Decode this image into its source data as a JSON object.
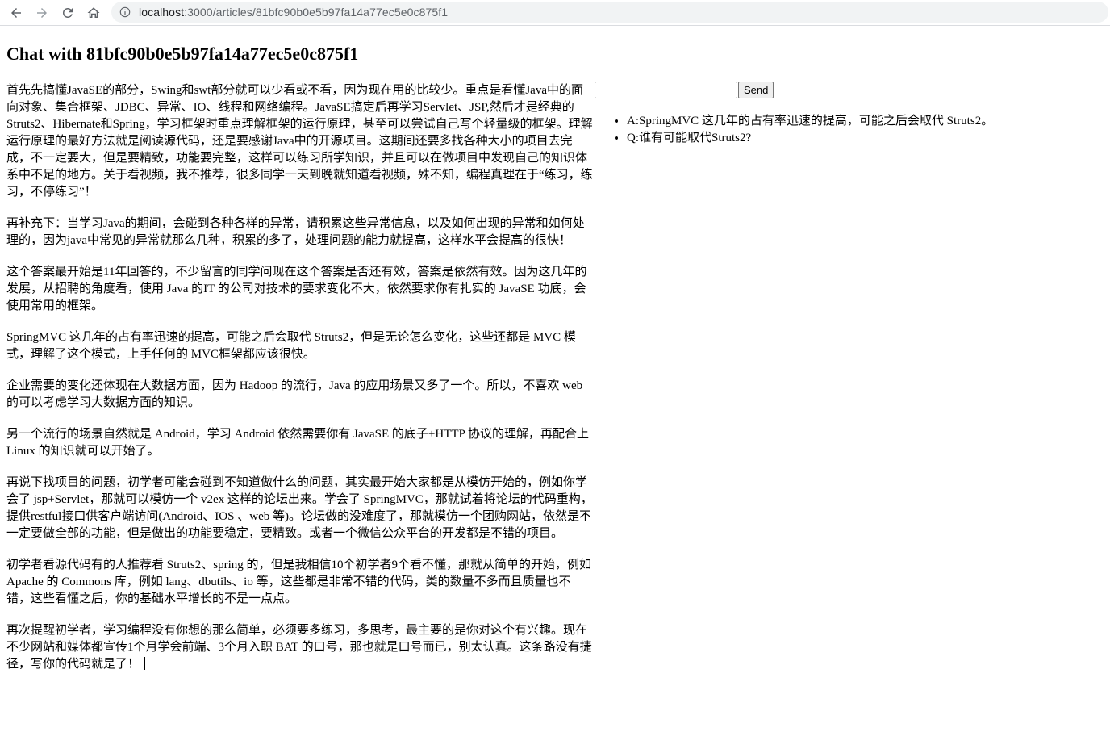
{
  "browser": {
    "url_host": "localhost",
    "url_path": ":3000/articles/81bfc90b0e5b97fa14a77ec5e0c875f1",
    "icons": {
      "back": "arrow-left-icon",
      "forward": "arrow-right-icon",
      "reload": "reload-icon",
      "home": "home-icon",
      "info": "info-icon"
    }
  },
  "page": {
    "title": "Chat with 81bfc90b0e5b97fa14a77ec5e0c875f1"
  },
  "article": {
    "paragraphs": [
      "首先先搞懂JavaSE的部分，Swing和swt部分就可以少看或不看，因为现在用的比较少。重点是看懂Java中的面向对象、集合框架、JDBC、异常、IO、线程和网络编程。JavaSE搞定后再学习Servlet、JSP,然后才是经典的Struts2、Hibernate和Spring，学习框架时重点理解框架的运行原理，甚至可以尝试自己写个轻量级的框架。理解运行原理的最好方法就是阅读源代码，还是要感谢Java中的开源项目。这期间还要多找各种大小的项目去完成，不一定要大，但是要精致，功能要完整，这样可以练习所学知识，并且可以在做项目中发现自己的知识体系中不足的地方。关于看视频，我不推荐，很多同学一天到晚就知道看视频，殊不知，编程真理在于“练习，练习，不停练习”！",
      "再补充下：当学习Java的期间，会碰到各种各样的异常，请积累这些异常信息，以及如何出现的异常和如何处理的，因为java中常见的异常就那么几种，积累的多了，处理问题的能力就提高，这样水平会提高的很快！",
      "这个答案最开始是11年回答的，不少留言的同学问现在这个答案是否还有效，答案是依然有效。因为这几年的发展，从招聘的角度看，使用 Java 的IT 的公司对技术的要求变化不大，依然要求你有扎实的 JavaSE 功底，会使用常用的框架。",
      "SpringMVC 这几年的占有率迅速的提高，可能之后会取代 Struts2，但是无论怎么变化，这些还都是 MVC 模式，理解了这个模式，上手任何的 MVC框架都应该很快。",
      "企业需要的变化还体现在大数据方面，因为 Hadoop 的流行，Java 的应用场景又多了一个。所以，不喜欢 web 的可以考虑学习大数据方面的知识。",
      "另一个流行的场景自然就是 Android，学习 Android 依然需要你有 JavaSE 的底子+HTTP 协议的理解，再配合上 Linux 的知识就可以开始了。",
      "再说下找项目的问题，初学者可能会碰到不知道做什么的问题，其实最开始大家都是从模仿开始的，例如你学会了 jsp+Servlet，那就可以模仿一个 v2ex 这样的论坛出来。学会了 SpringMVC，那就试着将论坛的代码重构，提供restful接口供客户端访问(Android、IOS 、web 等)。论坛做的没难度了，那就模仿一个团购网站，依然是不一定要做全部的功能，但是做出的功能要稳定，要精致。或者一个微信公众平台的开发都是不错的项目。",
      "初学者看源代码有的人推荐看 Struts2、spring 的，但是我相信10个初学者9个看不懂，那就从简单的开始，例如 Apache 的 Commons 库，例如 lang、dbutils、io 等，这些都是非常不错的代码，类的数量不多而且质量也不错，这些看懂之后，你的基础水平增长的不是一点点。",
      "再次提醒初学者，学习编程没有你想的那么简单，必须要多练习，多思考，最主要的是你对这个有兴趣。现在不少网站和媒体都宣传1个月学会前端、3个月入职 BAT 的口号，那也就是口号而已，别太认真。这条路没有捷径，写你的代码就是了！"
    ]
  },
  "chat": {
    "input_value": "",
    "input_placeholder": "",
    "send_label": "Send",
    "messages": [
      "A:SpringMVC 这几年的占有率迅速的提高，可能之后会取代 Struts2。",
      "Q:谁有可能取代Struts2?"
    ]
  }
}
